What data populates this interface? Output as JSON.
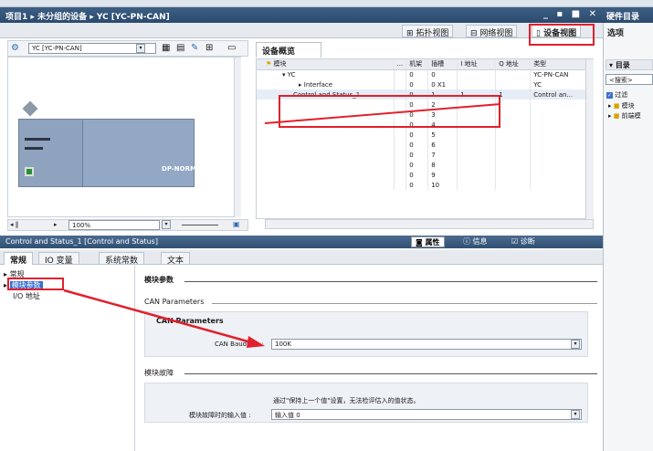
{
  "window": {
    "breadcrumb": [
      "项目1",
      "未分组的设备",
      "YC [YC-PN-CAN]"
    ],
    "controls": "_ ▪ ■ ✕",
    "right_title": "硬件目录"
  },
  "view_tabs": {
    "topology": "拓扑视图",
    "network": "网络视图",
    "device": "设备视图",
    "options": "选项"
  },
  "left": {
    "device_combo": "YC [YC-PN-CAN]",
    "module_label": "DP-NORM",
    "zoom": "100%"
  },
  "overview": {
    "tab_label": "设备概览",
    "columns": [
      "模块",
      "...",
      "机架",
      "插槽",
      "I 地址",
      "Q 地址",
      "类型"
    ],
    "rows": [
      {
        "module": "YC",
        "dots": "",
        "rack": "0",
        "slot": "0",
        "i_addr": "",
        "q_addr": "",
        "type": "YC-PN-CAN"
      },
      {
        "module": "Interface",
        "dots": "",
        "rack": "0",
        "slot": "0 X1",
        "i_addr": "",
        "q_addr": "",
        "type": "YC"
      },
      {
        "module": "Control and Status_1",
        "dots": "",
        "rack": "0",
        "slot": "1",
        "i_addr": "1",
        "q_addr": "1",
        "type": "Control an..."
      },
      {
        "module": "",
        "dots": "",
        "rack": "0",
        "slot": "2",
        "i_addr": "",
        "q_addr": "",
        "type": ""
      },
      {
        "module": "",
        "dots": "",
        "rack": "0",
        "slot": "3",
        "i_addr": "",
        "q_addr": "",
        "type": ""
      },
      {
        "module": "",
        "dots": "",
        "rack": "0",
        "slot": "4",
        "i_addr": "",
        "q_addr": "",
        "type": ""
      },
      {
        "module": "",
        "dots": "",
        "rack": "0",
        "slot": "5",
        "i_addr": "",
        "q_addr": "",
        "type": ""
      },
      {
        "module": "",
        "dots": "",
        "rack": "0",
        "slot": "6",
        "i_addr": "",
        "q_addr": "",
        "type": ""
      },
      {
        "module": "",
        "dots": "",
        "rack": "0",
        "slot": "7",
        "i_addr": "",
        "q_addr": "",
        "type": ""
      },
      {
        "module": "",
        "dots": "",
        "rack": "0",
        "slot": "8",
        "i_addr": "",
        "q_addr": "",
        "type": ""
      },
      {
        "module": "",
        "dots": "",
        "rack": "0",
        "slot": "9",
        "i_addr": "",
        "q_addr": "",
        "type": ""
      },
      {
        "module": "",
        "dots": "",
        "rack": "0",
        "slot": "10",
        "i_addr": "",
        "q_addr": "",
        "type": ""
      }
    ]
  },
  "catalog": {
    "title": "目录",
    "search": "<搜索>",
    "filter": "过滤",
    "items": [
      "模块",
      "前端模"
    ]
  },
  "inspector": {
    "title": "Control and Status_1 [Control and Status]",
    "tabs": [
      "属性",
      "信息",
      "诊断"
    ],
    "subtabs": [
      "常规",
      "IO 变量",
      "系统常数",
      "文本"
    ],
    "nav": [
      "常规",
      "模块参数",
      "I/O 地址"
    ],
    "section_module_params": "模块参数",
    "can_params_header": "CAN Parameters",
    "can_params_title": "CAN Parameters",
    "baud_label": "CAN Baudrate :",
    "baud_value": "100K",
    "section_fault": "模块故障",
    "fault_note": "通过\"保持上一个值\"设置，无法检评估入的值状态。",
    "fault_label": "模块故障时的输入值 :",
    "fault_value": "输入值 0"
  },
  "colors": {
    "highlight": "#e0202c",
    "selection": "#3b6fd1",
    "title_bar": "#2b4a6e"
  }
}
